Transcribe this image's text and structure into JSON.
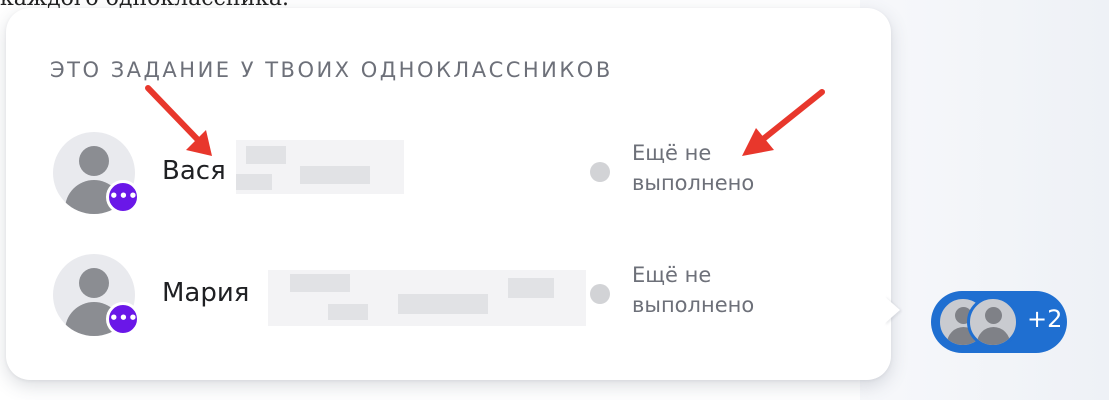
{
  "top_text": "каждого одноклассника.",
  "popup": {
    "title": "ЭТО ЗАДАНИЕ У ТВОИХ ОДНОКЛАССНИКОВ",
    "classmates": [
      {
        "name": "Вася",
        "status_line1": "Ещё не",
        "status_line2": "выполнено",
        "badge": "•••"
      },
      {
        "name": "Мария",
        "status_line1": "Ещё не",
        "status_line2": "выполнено",
        "badge": "•••"
      }
    ]
  },
  "more_chip": {
    "count": "+2"
  },
  "colors": {
    "badge": "#6a17e8",
    "chip": "#1f6fd1",
    "arrow": "#e8372c",
    "status_dot": "#d2d3d6"
  },
  "icons": {
    "avatar": "user-avatar-icon",
    "badge": "more-dots-icon",
    "status": "status-dot-icon",
    "annotation": "red-arrow-annotation"
  }
}
